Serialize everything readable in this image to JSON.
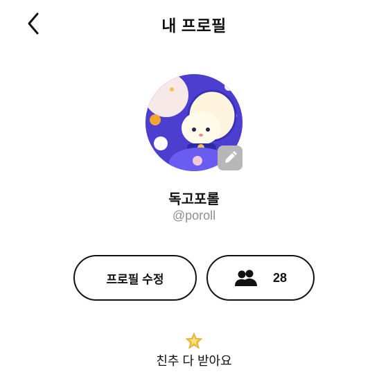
{
  "header": {
    "title": "내 프로필",
    "back_icon": "chevron-left-icon"
  },
  "profile": {
    "name": "독고포롤",
    "handle": "@poroll",
    "edit_icon": "pencil-icon"
  },
  "actions": {
    "edit_profile_label": "프로필 수정",
    "friends_icon": "people-icon",
    "friends_count": "28"
  },
  "promo": {
    "icon": "star-icon",
    "text": "친추 다 받아요"
  },
  "colors": {
    "text": "#111111",
    "handle_gray": "#8e8e93",
    "badge_gray": "#b7b7b9",
    "avatar_purple": "#5b4fd3"
  }
}
